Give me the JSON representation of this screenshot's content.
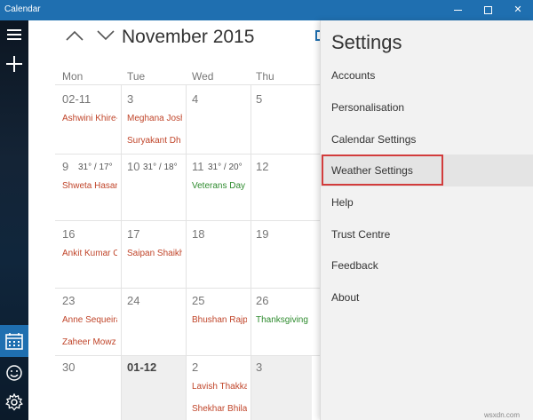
{
  "window": {
    "title": "Calendar",
    "minimize": "—",
    "close": "✕"
  },
  "rail": {
    "icons": [
      "menu-icon",
      "plus-icon",
      "calendar-icon",
      "smiley-icon",
      "gear-icon"
    ]
  },
  "header": {
    "month_title": "November 2015"
  },
  "weekdays": [
    "Mon",
    "Tue",
    "Wed",
    "Thu"
  ],
  "weeks": [
    {
      "days": [
        {
          "date": "02-11",
          "temp": "",
          "events": [
            {
              "text": "Ashwini Khire-",
              "kind": "bday"
            }
          ]
        },
        {
          "date": "3",
          "temp": "",
          "events": [
            {
              "text": "Meghana Josh",
              "kind": "bday"
            },
            {
              "text": "Suryakant Dh",
              "kind": "bday"
            }
          ]
        },
        {
          "date": "4",
          "temp": "",
          "events": []
        },
        {
          "date": "5",
          "temp": "",
          "events": []
        }
      ]
    },
    {
      "days": [
        {
          "date": "9",
          "temp": "31° / 17°",
          "events": [
            {
              "text": "Shweta Hasar",
              "kind": "bday"
            }
          ]
        },
        {
          "date": "10",
          "temp": "31° / 18°",
          "events": []
        },
        {
          "date": "11",
          "temp": "31° / 20°",
          "events": [
            {
              "text": "Veterans Day",
              "kind": "hol"
            }
          ]
        },
        {
          "date": "12",
          "temp": "",
          "events": []
        }
      ]
    },
    {
      "days": [
        {
          "date": "16",
          "temp": "",
          "events": [
            {
              "text": "Ankit Kumar C",
              "kind": "bday"
            }
          ]
        },
        {
          "date": "17",
          "temp": "",
          "events": [
            {
              "text": "Saipan Shaikh",
              "kind": "bday"
            }
          ]
        },
        {
          "date": "18",
          "temp": "",
          "events": []
        },
        {
          "date": "19",
          "temp": "",
          "events": []
        }
      ]
    },
    {
      "days": [
        {
          "date": "23",
          "temp": "",
          "events": [
            {
              "text": "Anne Sequeira",
              "kind": "bday"
            },
            {
              "text": "Zaheer Mowz",
              "kind": "bday"
            }
          ]
        },
        {
          "date": "24",
          "temp": "",
          "events": []
        },
        {
          "date": "25",
          "temp": "",
          "events": [
            {
              "text": "Bhushan Rajp",
              "kind": "bday"
            }
          ]
        },
        {
          "date": "26",
          "temp": "",
          "events": [
            {
              "text": "Thanksgiving",
              "kind": "hol"
            }
          ]
        }
      ]
    },
    {
      "days": [
        {
          "date": "30",
          "temp": "",
          "events": []
        },
        {
          "date": "01-12",
          "temp": "",
          "events": []
        },
        {
          "date": "2",
          "temp": "",
          "events": [
            {
              "text": "Lavish Thakka",
              "kind": "bday"
            },
            {
              "text": "Shekhar Bhilar",
              "kind": "bday"
            }
          ]
        },
        {
          "date": "3",
          "temp": "",
          "events": []
        }
      ]
    }
  ],
  "settings": {
    "title": "Settings",
    "items": [
      "Accounts",
      "Personalisation",
      "Calendar Settings",
      "Weather Settings",
      "Help",
      "Trust Centre",
      "Feedback",
      "About"
    ],
    "selected": "Weather Settings"
  },
  "watermark": "wsxdn.com",
  "colors": {
    "accent": "#1f6fb0",
    "birthday": "#c0452a",
    "holiday": "#2e8b2e",
    "highlight_border": "#d23c3c"
  }
}
